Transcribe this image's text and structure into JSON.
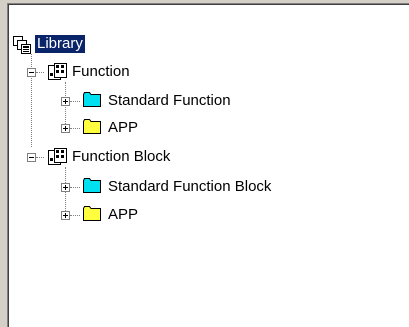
{
  "tree": {
    "root": {
      "label": "Library",
      "icon": "library-icon"
    },
    "function": {
      "label": "Function",
      "icon": "function-group-icon",
      "children": [
        {
          "label": "Standard Function",
          "icon": "cyan-folder-icon",
          "color": "#00e0f0"
        },
        {
          "label": "APP",
          "icon": "yellow-folder-icon",
          "color": "#ffff40"
        }
      ]
    },
    "function_block": {
      "label": "Function Block",
      "icon": "function-group-icon",
      "children": [
        {
          "label": "Standard Function Block",
          "icon": "cyan-folder-icon",
          "color": "#00e0f0"
        },
        {
          "label": "APP",
          "icon": "yellow-folder-icon",
          "color": "#ffff40"
        }
      ]
    }
  }
}
